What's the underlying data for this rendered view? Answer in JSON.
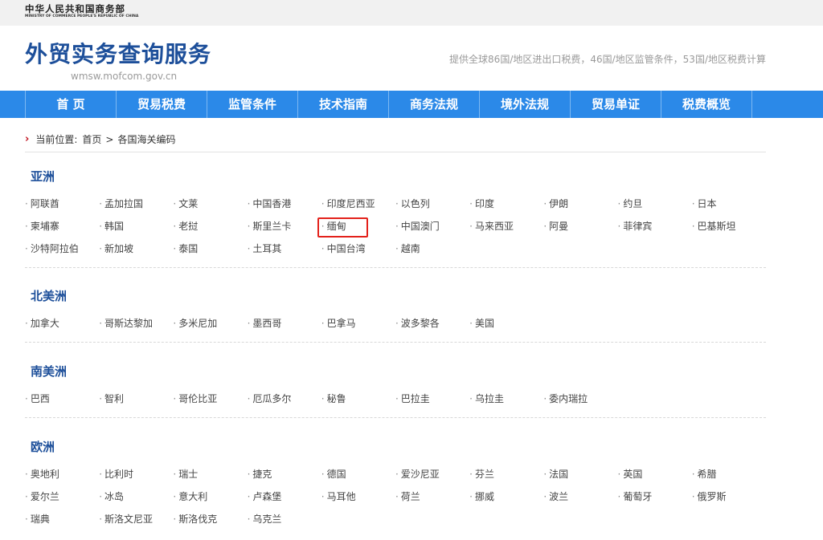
{
  "header": {
    "ministry_cn": "中华人民共和国商务部",
    "ministry_en": "MINISTRY OF COMMERCE PEOPLE'S REPUBLIC OF CHINA",
    "site_title": "外贸实务查询服务",
    "site_url": "wmsw.mofcom.gov.cn",
    "tagline": "提供全球86国/地区进出口税费，46国/地区监管条件，53国/地区税费计算"
  },
  "nav": {
    "items": [
      "首 页",
      "贸易税费",
      "监管条件",
      "技术指南",
      "商务法规",
      "境外法规",
      "贸易单证",
      "税费概览"
    ]
  },
  "breadcrumb": {
    "prefix": "当前位置:",
    "home": "首页",
    "separator": ">",
    "current": "各国海关编码"
  },
  "regions": [
    {
      "title": "亚洲",
      "countries": [
        "阿联酋",
        "孟加拉国",
        "文莱",
        "中国香港",
        "印度尼西亚",
        "以色列",
        "印度",
        "伊朗",
        "约旦",
        "日本",
        "柬埔寨",
        "韩国",
        "老挝",
        "斯里兰卡",
        "缅甸",
        "中国澳门",
        "马来西亚",
        "阿曼",
        "菲律宾",
        "巴基斯坦",
        "沙特阿拉伯",
        "新加坡",
        "泰国",
        "土耳其",
        "中国台湾",
        "越南"
      ]
    },
    {
      "title": "北美洲",
      "countries": [
        "加拿大",
        "哥斯达黎加",
        "多米尼加",
        "墨西哥",
        "巴拿马",
        "波多黎各",
        "美国"
      ]
    },
    {
      "title": "南美洲",
      "countries": [
        "巴西",
        "智利",
        "哥伦比亚",
        "厄瓜多尔",
        "秘鲁",
        "巴拉圭",
        "乌拉圭",
        "委内瑞拉"
      ]
    },
    {
      "title": "欧洲",
      "countries": [
        "奥地利",
        "比利时",
        "瑞士",
        "捷克",
        "德国",
        "爱沙尼亚",
        "芬兰",
        "法国",
        "英国",
        "希腊",
        "爱尔兰",
        "冰岛",
        "意大利",
        "卢森堡",
        "马耳他",
        "荷兰",
        "挪威",
        "波兰",
        "葡萄牙",
        "俄罗斯",
        "瑞典",
        "斯洛文尼亚",
        "斯洛伐克",
        "乌克兰"
      ]
    }
  ],
  "colors": {
    "brand_blue": "#1d4f9a",
    "nav_blue": "#2b89e8",
    "highlight_red": "#e3211b"
  }
}
